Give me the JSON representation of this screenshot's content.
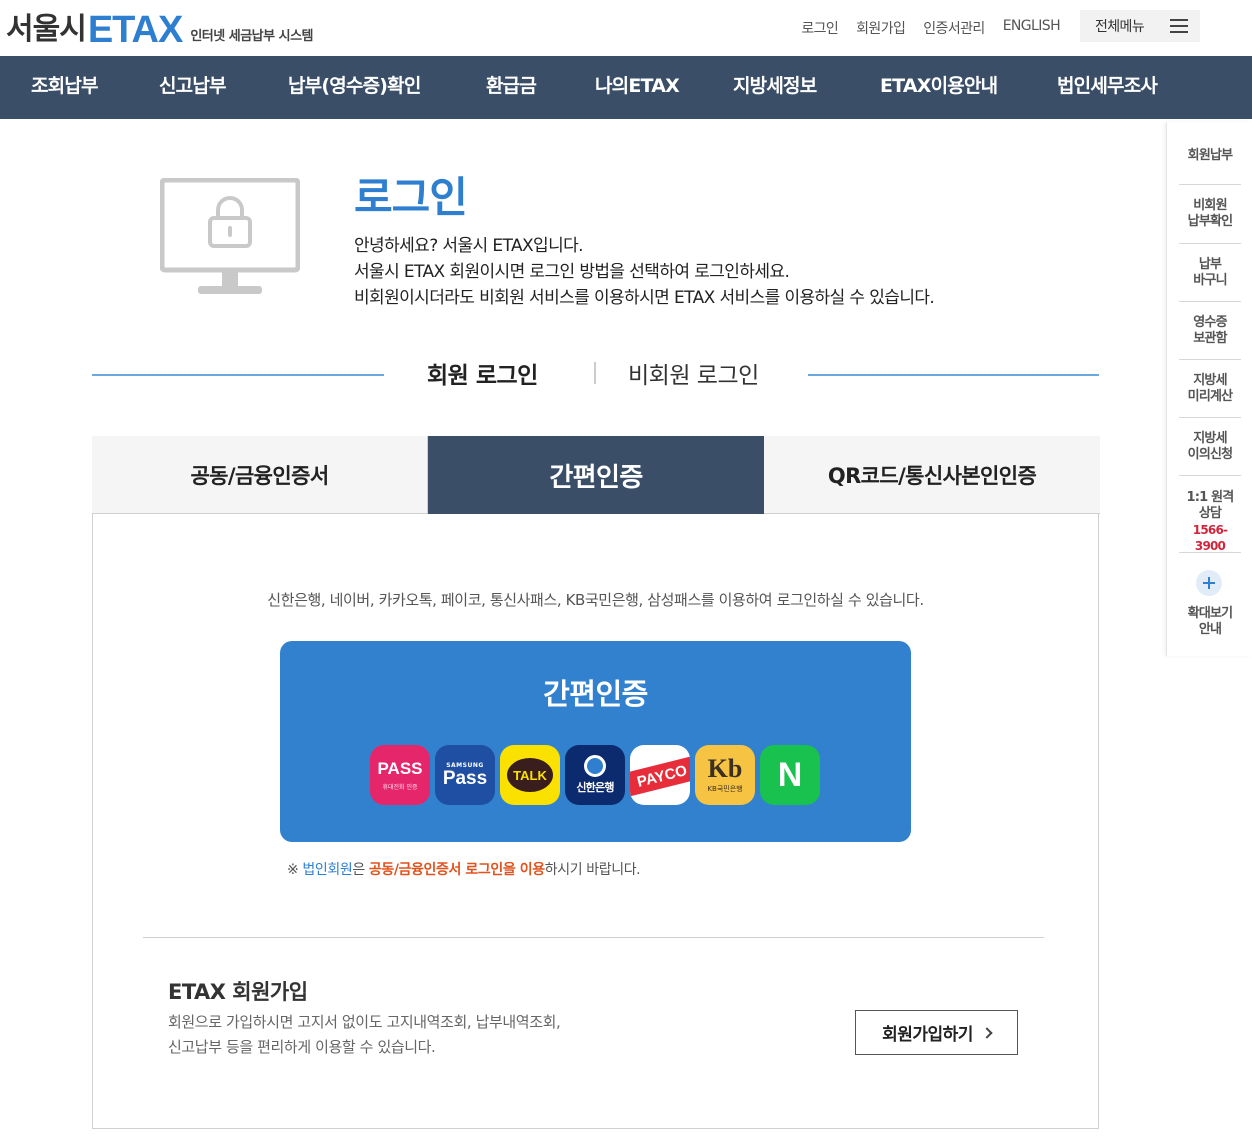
{
  "header": {
    "logo_city": "서울시",
    "logo_etax": "ETAX",
    "logo_sub": "인터넷 세금납부 시스템",
    "util_links": [
      "로그인",
      "회원가입",
      "인증서관리",
      "ENGLISH"
    ],
    "all_menu": "전체메뉴"
  },
  "gnb": [
    "조회납부",
    "신고납부",
    "납부(영수증)확인",
    "환급금",
    "나의ETAX",
    "지방세정보",
    "ETAX이용안내",
    "법인세무조사"
  ],
  "quick_menu": {
    "member_pay": "회원납부",
    "nonmember_line1": "비회원",
    "nonmember_line2": "납부확인",
    "basket_line1": "납부",
    "basket_line2": "바구니",
    "receipt_line1": "영수증",
    "receipt_line2": "보관함",
    "calc_line1": "지방세",
    "calc_line2": "미리계산",
    "appeal_line1": "지방세",
    "appeal_line2": "이의신청",
    "consult_line1": "1:1 원격",
    "consult_line2": "상담",
    "consult_phone": "1566-3900",
    "zoom_line1": "확대보기",
    "zoom_line2": "안내"
  },
  "intro": {
    "title": "로그인",
    "line1": "안녕하세요? 서울시 ETAX입니다.",
    "line2": "서울시 ETAX 회원이시면 로그인 방법을 선택하여 로그인하세요.",
    "line3": "비회원이시더라도 비회원 서비스를 이용하시면 ETAX 서비스를 이용하실 수 있습니다."
  },
  "member_toggle": {
    "member": "회원 로그인",
    "nonmember": "비회원 로그인"
  },
  "tabs": [
    "공동/금융인증서",
    "간편인증",
    "QR코드/통신사본인인증"
  ],
  "easy_auth": {
    "description": "신한은행, 네이버, 카카오톡, 페이코, 통신사패스, KB국민은행, 삼성패스를 이용하여 로그인하실 수 있습니다.",
    "button_title": "간편인증",
    "providers": {
      "pass_big": "PASS",
      "pass_small": "휴대전화 인증",
      "samsung_small": "SAMSUNG",
      "samsung_big": "Pass",
      "kakao": "TALK",
      "shinhan": "신한은행",
      "payco": "PAYCO",
      "kb_big": "Kb",
      "kb_small": "KB국민은행",
      "naver": "N"
    }
  },
  "notice": {
    "mark": "※",
    "part1": "법인회원",
    "part2": "은 ",
    "part3": "공동/금융인증서 로그인을 이용",
    "part4": "하시기 바랍니다."
  },
  "join": {
    "title": "ETAX 회원가입",
    "desc_line1": "회원으로 가입하시면 고지서 없이도 고지내역조회, 납부내역조회,",
    "desc_line2": "신고납부 등을 편리하게 이용할 수 있습니다.",
    "button": "회원가입하기"
  },
  "colors": {
    "brand_blue": "#2f7fd0",
    "nav_navy": "#3a4e68",
    "easy_button": "#3181cf",
    "notice_orange": "#e0531f",
    "phone_red": "#d0263d"
  }
}
